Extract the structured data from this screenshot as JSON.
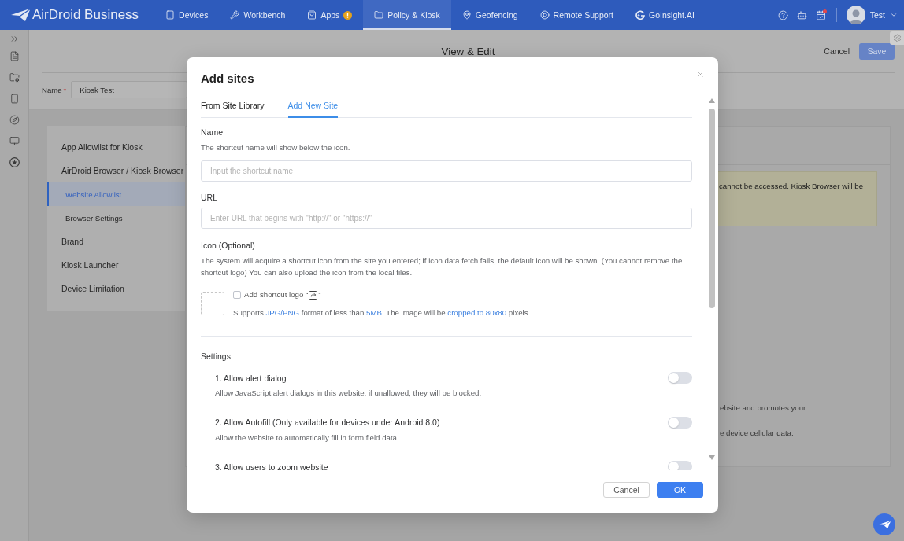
{
  "nav": {
    "logo": "AirDroid Business",
    "items": [
      {
        "label": "Devices",
        "selected": false,
        "alert": false
      },
      {
        "label": "Workbench",
        "selected": false,
        "alert": false
      },
      {
        "label": "Apps",
        "selected": false,
        "alert": true
      },
      {
        "label": "Policy & Kiosk",
        "selected": true,
        "alert": false
      },
      {
        "label": "Geofencing",
        "selected": false,
        "alert": false
      },
      {
        "label": "Remote Support",
        "selected": false,
        "alert": false
      },
      {
        "label": "GoInsight.AI",
        "selected": false,
        "alert": false
      }
    ],
    "notification_dot": true,
    "user": "Test"
  },
  "page": {
    "title": "View & Edit",
    "actions": [
      {
        "label": "Cancel",
        "kind": "text"
      },
      {
        "label": "Save",
        "kind": "primary"
      }
    ],
    "name_field": {
      "label": "Name",
      "required_mark": "*",
      "value": "Kiosk Test"
    }
  },
  "menu": [
    {
      "label": "App Allowlist for Kiosk",
      "selected": false
    },
    {
      "label": "AirDroid Browser / Kiosk Browser",
      "selected": false,
      "children": [
        {
          "label": "Website Allowlist",
          "selected": true
        },
        {
          "label": "Browser Settings",
          "selected": false
        }
      ]
    },
    {
      "label": "Brand",
      "selected": false
    },
    {
      "label": "Kiosk Launcher",
      "selected": false
    },
    {
      "label": "Device Limitation",
      "selected": false
    }
  ],
  "panel": {
    "notice": "cannot be accessed. Kiosk Browser will be",
    "lines": [
      "ebsite and promotes your",
      "e device cellular data."
    ]
  },
  "dialog": {
    "title": "Add sites",
    "tabs": [
      {
        "label": "From Site Library",
        "selected": false
      },
      {
        "label": "Add New Site",
        "selected": true
      }
    ],
    "fields": [
      {
        "label": "Name",
        "hint": "The shortcut name will show below the icon.",
        "placeholder": "Input the shortcut name"
      },
      {
        "label": "URL",
        "placeholder": "Enter URL that begins with \"http://\" or \"https://\""
      }
    ],
    "icon_section": {
      "label": "Icon (Optional)",
      "description": "The system will acquire a shortcut icon from the site you entered; if icon data fetch fails, the default icon will be shown. (You cannot remove the shortcut logo) You can also upload the icon from the local files.",
      "logo_option": {
        "label": "Add shortcut logo “",
        "label_end": "”",
        "checked": false
      },
      "note": [
        {
          "text": "Supports ",
          "highlight": false
        },
        {
          "text": "JPG/PNG",
          "highlight": true
        },
        {
          "text": " format of less than ",
          "highlight": false
        },
        {
          "text": "5MB",
          "highlight": true
        },
        {
          "text": ". The image will be ",
          "highlight": false
        },
        {
          "text": "cropped to 80x80",
          "highlight": true
        },
        {
          "text": " pixels.",
          "highlight": false
        }
      ]
    },
    "settings": {
      "title": "Settings",
      "items": [
        {
          "title": "1. Allow alert dialog",
          "description": "Allow JavaScript alert dialogs in this website, if unallowed, they will be blocked.",
          "on": false
        },
        {
          "title": "2. Allow Autofill (Only available for devices under Android 8.0)",
          "description": "Allow the website to automatically fill in form field data.",
          "on": false
        },
        {
          "title": "3. Allow users to zoom website",
          "on": false
        }
      ]
    },
    "buttons": [
      {
        "label": "Cancel",
        "kind": "secondary"
      },
      {
        "label": "OK",
        "kind": "primary"
      }
    ]
  }
}
